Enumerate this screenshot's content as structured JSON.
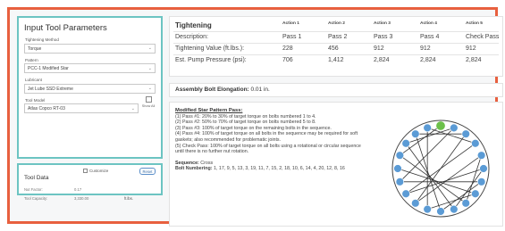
{
  "left_panel": {
    "title": "Input Tool Parameters",
    "tightening_method": {
      "label": "Tightening Method",
      "value": "Torque"
    },
    "pattern": {
      "label": "Pattern",
      "value": "PCC-1 Modified Star"
    },
    "lubricant": {
      "label": "Lubricant",
      "value": "Jet Lube SSD Extreme"
    },
    "tool_model": {
      "label": "Tool Model",
      "value": "Atlas Copco RT-03",
      "show_all": "Show All"
    }
  },
  "tool_data": {
    "title": "Tool Data",
    "customize_label": "Customize",
    "reset_label": "Reset",
    "rows": [
      {
        "label": "Nut Factor:",
        "value": "0.17",
        "unit": ""
      },
      {
        "label": "Tool Capacity:",
        "value": "3,330.00",
        "unit": "ft.lbs."
      }
    ]
  },
  "tightening": {
    "title": "Tightening",
    "columns": [
      "Action 1",
      "Action 2",
      "Action 3",
      "Action 4",
      "Action 5"
    ],
    "rows": [
      {
        "label": "Description:",
        "values": [
          "Pass 1",
          "Pass 2",
          "Pass 3",
          "Pass 4",
          "Check Pass"
        ]
      },
      {
        "label": "Tightening Value (ft.lbs.):",
        "values": [
          "228",
          "456",
          "912",
          "912",
          "912"
        ]
      },
      {
        "label": "Est. Pump Pressure (psi):",
        "values": [
          "706",
          "1,412",
          "2,824",
          "2,824",
          "2,824"
        ]
      }
    ]
  },
  "elongation": {
    "label": "Assembly Bolt Elongation:",
    "value": "0.01 in."
  },
  "pattern_info": {
    "title": "Modified Star Pattern Pass:",
    "lines": [
      "(1) Pass #1: 20% to 30% of target torque on bolts numbered 1 to 4.",
      "(2) Pass #2: 50% to 70% of target torque on bolts numbered 5 to 8.",
      "(3) Pass #3: 100% of target torque on the remaining bolts in the sequence.",
      "(4) Pass #4: 100% of target torque on all bolts in the sequence may be required for soft gaskets; also recommended for problematic joints.",
      "(5) Check Pass: 100% of target torque on all bolts using a rotational or circular sequence until there is no further nut rotation."
    ],
    "sequence_label": "Sequence:",
    "sequence_value": "Cross",
    "numbering_label": "Bolt Numbering:",
    "numbering_value": "1, 17, 9, 5, 13, 3, 19, 11, 7, 15, 2, 18, 10, 6, 14, 4, 20, 12, 8, 16"
  },
  "bolt_diagram": {
    "bolt_count": 20,
    "highlight_index": 0,
    "colors": {
      "bolt": "#5b9bd5",
      "highlight": "#6cc04a",
      "ring": "#444444",
      "line": "#333333",
      "frame": "#e8603f",
      "panel_border": "#6cc4c2"
    },
    "pass_order": [
      1,
      17,
      9,
      5,
      13,
      3,
      19,
      11,
      7,
      15,
      2,
      18,
      10,
      6,
      14,
      4,
      20,
      12,
      8,
      16
    ]
  }
}
